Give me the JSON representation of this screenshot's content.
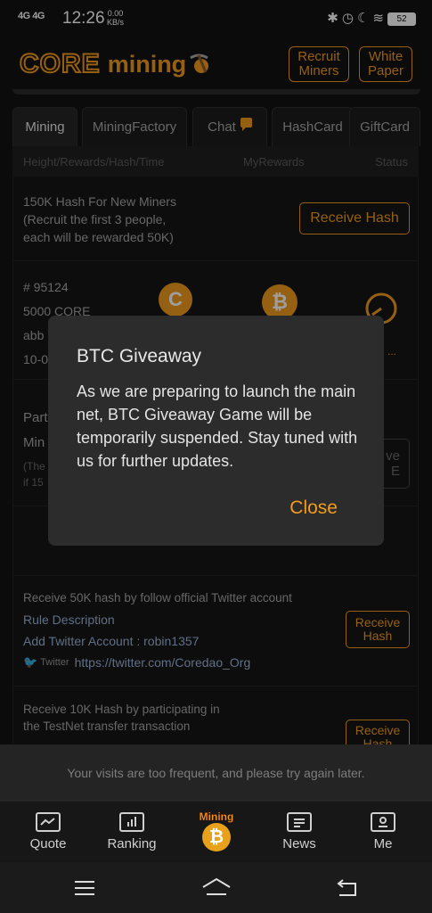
{
  "status_bar": {
    "network": "4G 4G",
    "time": "12:26",
    "speed_value": "0.00",
    "speed_unit": "KB/s",
    "battery": "52"
  },
  "header": {
    "logo_core": "CORE",
    "logo_mining": "mining",
    "recruit_label": "Recruit Miners",
    "whitepaper_label": "White Paper"
  },
  "tabs": [
    {
      "label": "Mining",
      "active": true
    },
    {
      "label": "MiningFactory"
    },
    {
      "label": "Chat"
    },
    {
      "label": "HashCard"
    },
    {
      "label": "GiftCard"
    }
  ],
  "columns": {
    "left": "Height/Rewards/Hash/Time",
    "mid": "MyRewards",
    "right": "Status"
  },
  "new_miners": {
    "line1": "150K Hash For New Miners",
    "line2": "(Recruit the first 3 people,",
    "line3": "each will be rewarded 50K)",
    "button": "Receive Hash"
  },
  "block": {
    "height": "# 95124",
    "reward": "5000 CORE",
    "hash_partial": "abb",
    "time_partial": "10-0",
    "status_partial": "g ..."
  },
  "partial_row": {
    "line1": "Part",
    "line2": "Min",
    "line3": "(The",
    "line4": "if 15",
    "btn_frag1": "ve",
    "btn_frag2": "E"
  },
  "twitter_task": {
    "title": "Receive 50K hash by follow official Twitter account",
    "rule": "Rule Description",
    "account": "Add Twitter Account : robin1357",
    "twitter_label": "Twitter",
    "url": "https://twitter.com/Coredao_Org",
    "button": "Receive Hash"
  },
  "testnet_task": {
    "line1": "Receive 10K Hash by participating in",
    "line2": "the TestNet transfer transaction",
    "button": "Receive Hash"
  },
  "modal": {
    "title": "BTC Giveaway",
    "body": "As we are preparing to launch the main net, BTC Giveaway Game will be temporarily suspended. Stay tuned with us for further updates.",
    "close": "Close"
  },
  "toast": "Your visits are too frequent, and please try again later.",
  "bottom_nav": [
    {
      "label": "Quote",
      "icon": "chart-line-icon"
    },
    {
      "label": "Ranking",
      "icon": "bar-chart-icon"
    },
    {
      "label": "Mining",
      "icon": "bitcoin-mining-icon"
    },
    {
      "label": "News",
      "icon": "news-icon"
    },
    {
      "label": "Me",
      "icon": "user-card-icon"
    }
  ],
  "colors": {
    "accent": "#f29b1d",
    "background": "#121212",
    "modal": "#2c2c2c"
  }
}
